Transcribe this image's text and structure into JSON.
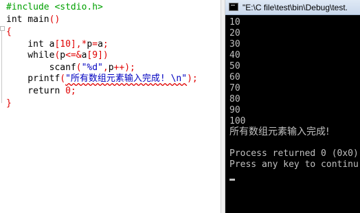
{
  "editor": {
    "lines": [
      {
        "parts": [
          {
            "t": "#include <stdio.h>",
            "c": "pre"
          }
        ]
      },
      {
        "parts": [
          {
            "t": "int main",
            "c": "id"
          },
          {
            "t": "()",
            "c": "op"
          }
        ]
      },
      {
        "parts": [
          {
            "t": "{",
            "c": "op"
          }
        ]
      },
      {
        "parts": [
          {
            "t": "    int a",
            "c": "id"
          },
          {
            "t": "[",
            "c": "op"
          },
          {
            "t": "10",
            "c": "num"
          },
          {
            "t": "],*",
            "c": "op"
          },
          {
            "t": "p",
            "c": "id"
          },
          {
            "t": "=",
            "c": "op"
          },
          {
            "t": "a",
            "c": "id"
          },
          {
            "t": ";",
            "c": "op"
          }
        ]
      },
      {
        "parts": [
          {
            "t": "    while",
            "c": "id"
          },
          {
            "t": "(",
            "c": "op"
          },
          {
            "t": "p",
            "c": "id"
          },
          {
            "t": "<=&",
            "c": "op"
          },
          {
            "t": "a",
            "c": "id"
          },
          {
            "t": "[",
            "c": "op"
          },
          {
            "t": "9",
            "c": "num"
          },
          {
            "t": "])",
            "c": "op"
          }
        ]
      },
      {
        "parts": [
          {
            "t": "        scanf",
            "c": "id"
          },
          {
            "t": "(",
            "c": "op"
          },
          {
            "t": "\"%d\"",
            "c": "str"
          },
          {
            "t": ",",
            "c": "op"
          },
          {
            "t": "p",
            "c": "id"
          },
          {
            "t": "++);",
            "c": "op"
          }
        ]
      },
      {
        "parts": [
          {
            "t": "    printf",
            "c": "id"
          },
          {
            "t": "(",
            "c": "op"
          },
          {
            "t": "\"所有数组元素输入完成! \\n\"",
            "c": "str",
            "squiggle": true
          },
          {
            "t": ");",
            "c": "op"
          }
        ]
      },
      {
        "parts": [
          {
            "t": "    return ",
            "c": "id"
          },
          {
            "t": "0",
            "c": "num"
          },
          {
            "t": ";",
            "c": "op"
          }
        ]
      },
      {
        "parts": [
          {
            "t": "}",
            "c": "op"
          }
        ]
      }
    ]
  },
  "console": {
    "title": "\"E:\\C file\\test\\bin\\Debug\\test.",
    "output": [
      "10",
      "20",
      "30",
      "40",
      "50",
      "60",
      "70",
      "80",
      "90",
      "100",
      "所有数组元素输入完成!",
      "",
      "Process returned 0 (0x0)",
      "Press any key to continu"
    ]
  }
}
